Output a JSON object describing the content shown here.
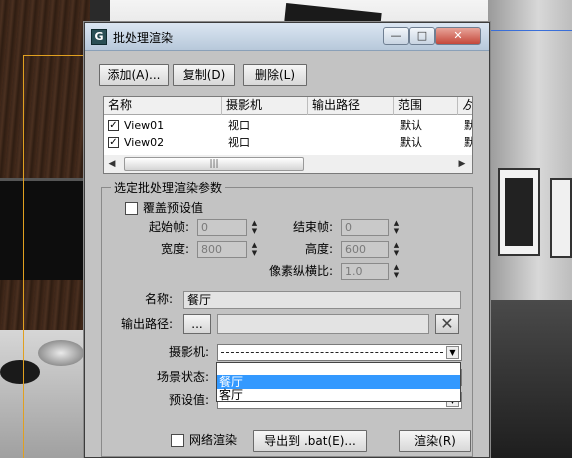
{
  "window": {
    "title": "批处理渲染"
  },
  "toolbar": {
    "add_label": "添加(A)...",
    "copy_label": "复制(D)",
    "delete_label": "删除(L)"
  },
  "list": {
    "columns": [
      "名称",
      "摄影机",
      "输出路径",
      "范围",
      "ゟ"
    ],
    "rows": [
      {
        "checked": true,
        "name": "View01",
        "camera": "视口",
        "output": "",
        "range": "默认",
        "extra": "默"
      },
      {
        "checked": true,
        "name": "View02",
        "camera": "视口",
        "output": "",
        "range": "默认",
        "extra": "默"
      }
    ],
    "scroll_thumb": "|||"
  },
  "params": {
    "group_title": "选定批处理渲染参数",
    "override_label": "覆盖预设值",
    "start_frame_label": "起始帧:",
    "start_frame_value": "0",
    "end_frame_label": "结束帧:",
    "end_frame_value": "0",
    "width_label": "宽度:",
    "width_value": "800",
    "height_label": "高度:",
    "height_value": "600",
    "pixel_aspect_label": "像素纵横比:",
    "pixel_aspect_value": "1.0",
    "name_label": "名称:",
    "name_value": "餐厅",
    "output_path_label": "输出路径:",
    "output_browse": "...",
    "output_path_value": "",
    "camera_label": "摄影机:",
    "scene_state_label": "场景状态:",
    "preset_label": "预设值:"
  },
  "dropdown": {
    "options": [
      "",
      "餐厅",
      "客厅"
    ],
    "selected": "餐厅"
  },
  "bottom": {
    "network_render_label": "网络渲染",
    "export_label": "导出到 .bat(E)...",
    "render_label": "渲染(R)"
  },
  "colors": {
    "dialog_bg": "#c3c3c3",
    "selection": "#3399ff"
  }
}
